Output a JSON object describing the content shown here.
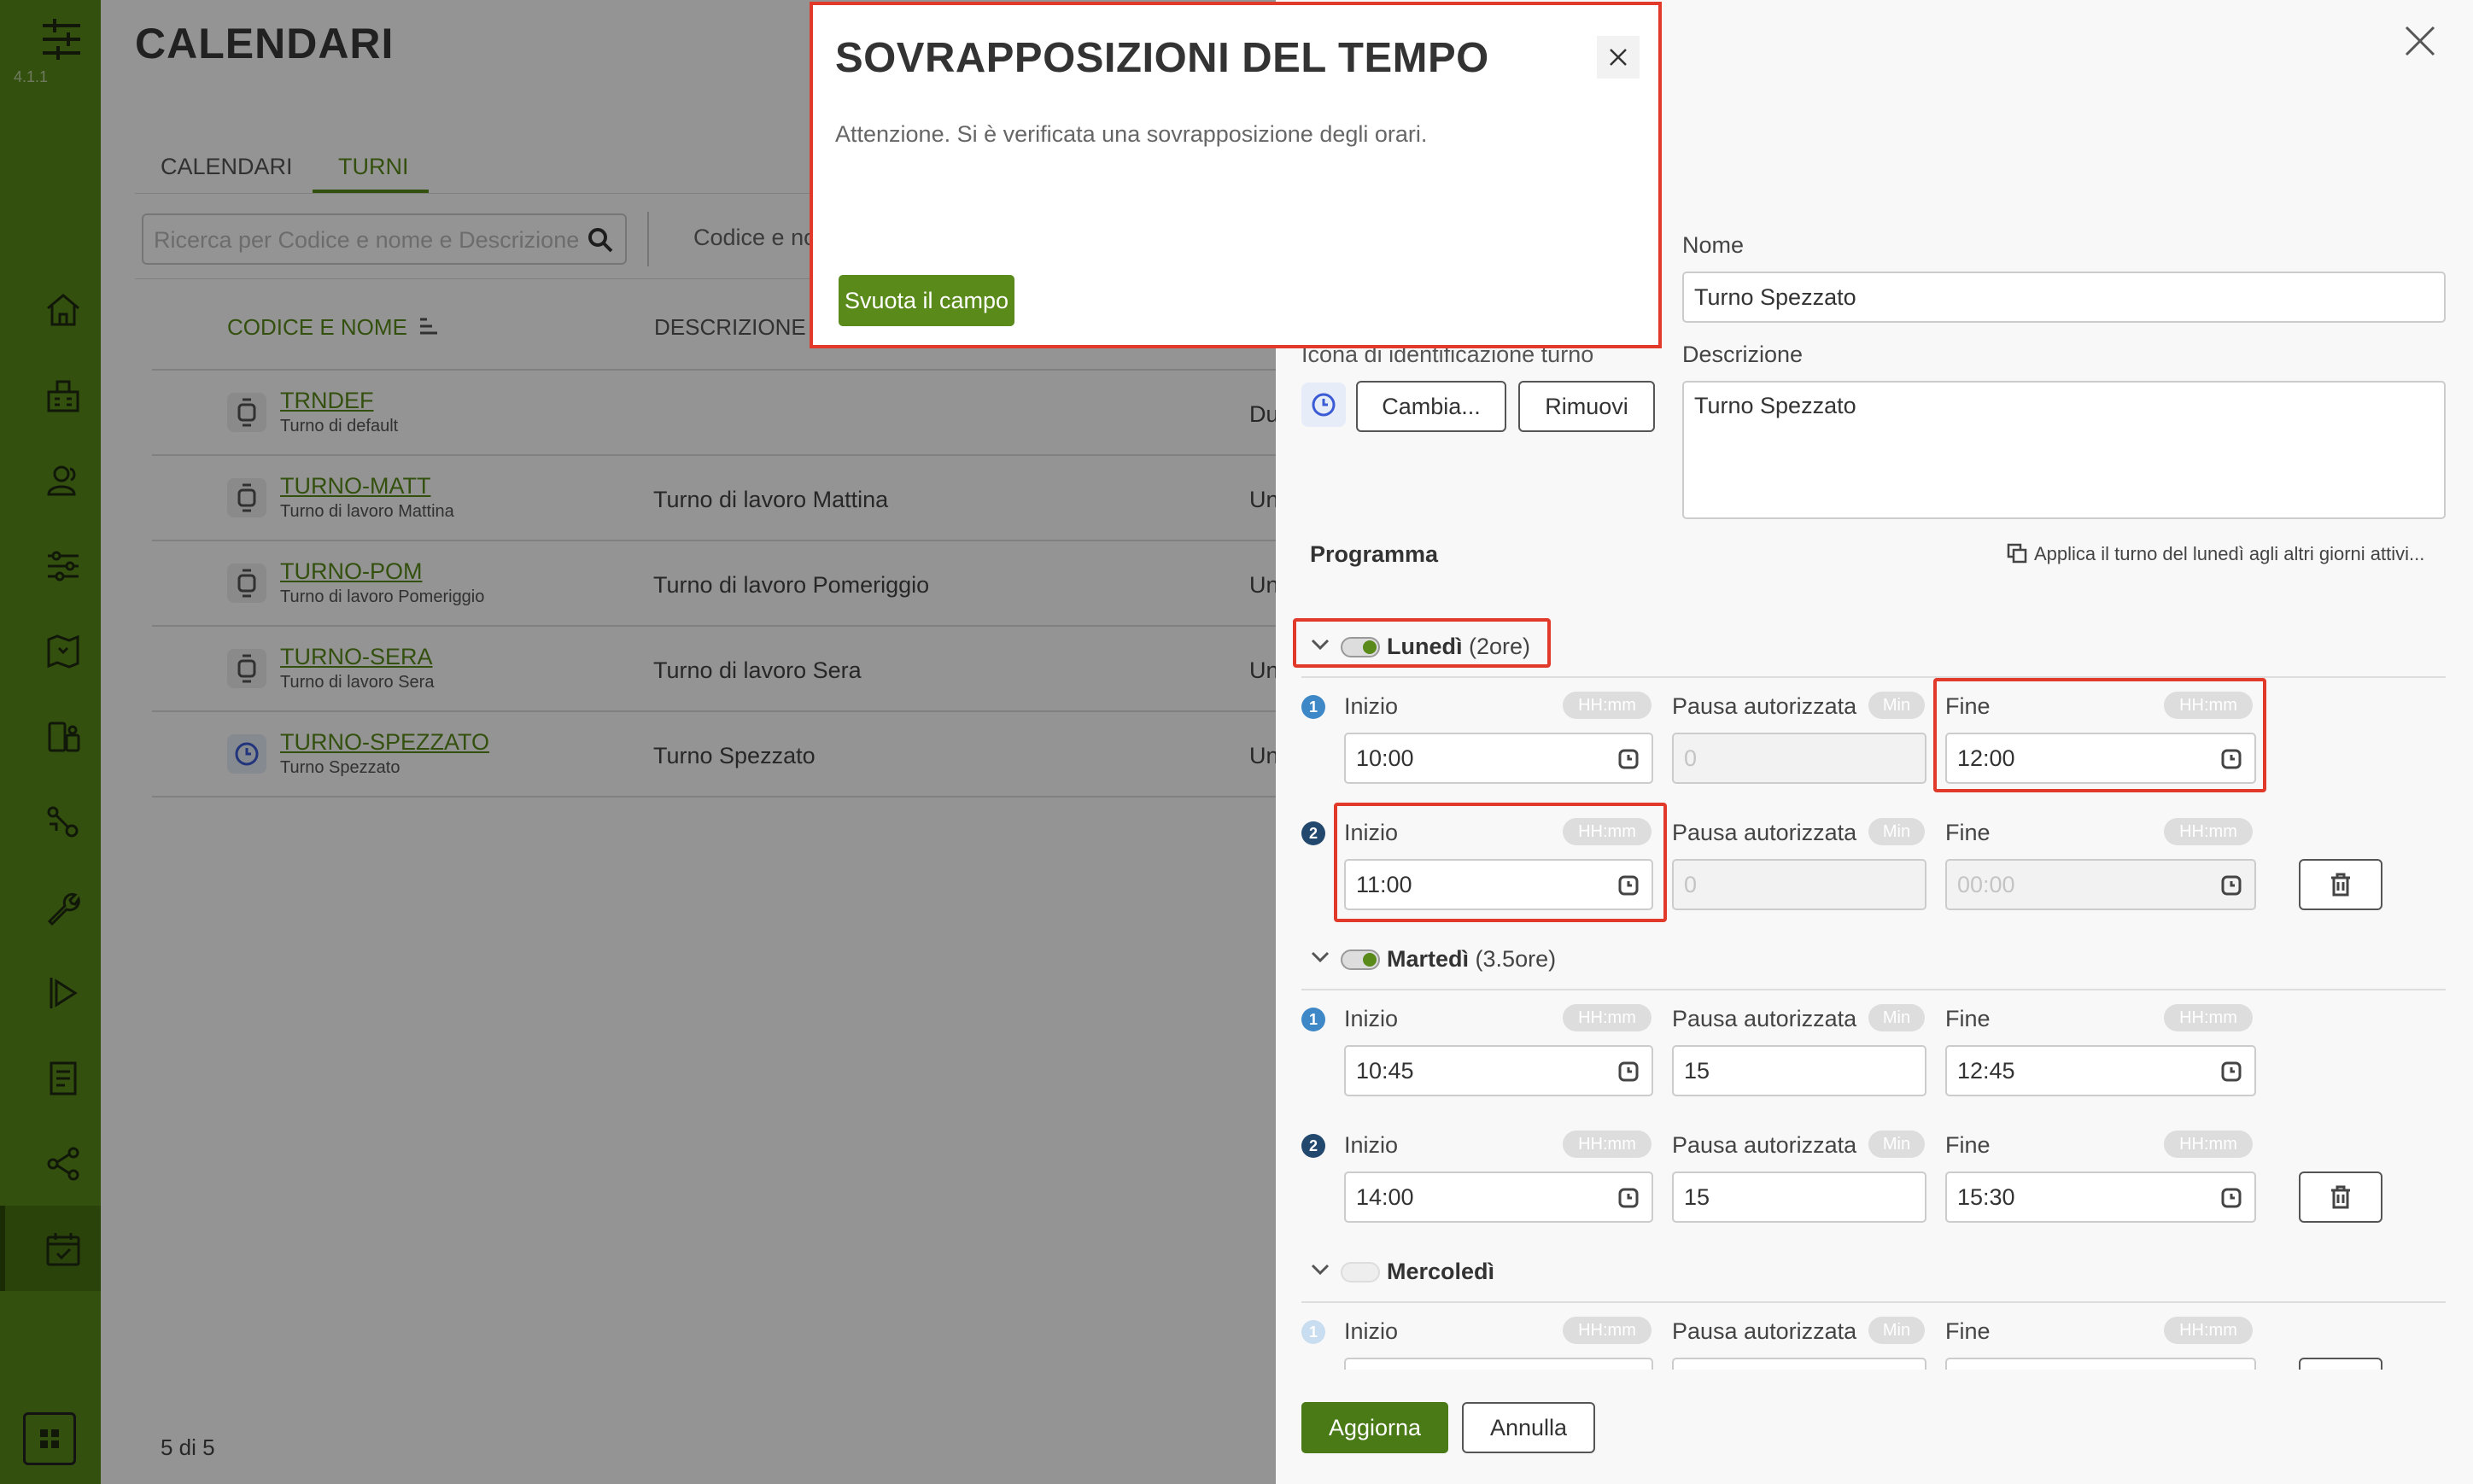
{
  "app": {
    "version": "4.1.1"
  },
  "page": {
    "title": "CALENDARI"
  },
  "tabs": [
    {
      "label": "CALENDARI"
    },
    {
      "label": "TURNI"
    }
  ],
  "search": {
    "placeholder": "Ricerca per Codice e nome e Descrizione",
    "filter_label": "Codice e no"
  },
  "table": {
    "headers": {
      "code_name": "CODICE E NOME",
      "description": "DESCRIZIONE"
    },
    "rows": [
      {
        "code": "TRNDEF",
        "subtitle": "Turno di default",
        "description": "",
        "extra": "Du"
      },
      {
        "code": "TURNO-MATT",
        "subtitle": "Turno di lavoro Mattina",
        "description": "Turno di lavoro Mattina",
        "extra": "Un"
      },
      {
        "code": "TURNO-POM",
        "subtitle": "Turno di lavoro Pomeriggio",
        "description": "Turno di lavoro Pomeriggio",
        "extra": "Un"
      },
      {
        "code": "TURNO-SERA",
        "subtitle": "Turno di lavoro Sera",
        "description": "Turno di lavoro Sera",
        "extra": "Un"
      },
      {
        "code": "TURNO-SPEZZATO",
        "subtitle": "Turno Spezzato",
        "description": "Turno Spezzato",
        "extra": "Un"
      }
    ],
    "count": "5 di 5"
  },
  "drawer": {
    "nome_label": "Nome",
    "nome_value": "Turno Spezzato",
    "icona_label": "Icona di identificazione turno",
    "cambia_label": "Cambia...",
    "rimuovi_label": "Rimuovi",
    "descrizione_label": "Descrizione",
    "descrizione_value": "Turno Spezzato",
    "programma_label": "Programma",
    "apply_label": "Applica il turno del lunedì agli altri giorni attivi...",
    "field_labels": {
      "inizio": "Inizio",
      "pausa": "Pausa autorizzata",
      "fine": "Fine",
      "hhmm": "HH:mm",
      "min": "Min"
    },
    "days": [
      {
        "name": "Lunedì",
        "hours": "(2ore)",
        "slots": [
          {
            "n": "1",
            "inizio": "10:00",
            "pausa": "0",
            "fine": "12:00"
          },
          {
            "n": "2",
            "inizio": "11:00",
            "pausa": "0",
            "fine": "00:00"
          }
        ]
      },
      {
        "name": "Martedì",
        "hours": "(3.5ore)",
        "slots": [
          {
            "n": "1",
            "inizio": "10:45",
            "pausa": "15",
            "fine": "12:45"
          },
          {
            "n": "2",
            "inizio": "14:00",
            "pausa": "15",
            "fine": "15:30"
          }
        ]
      },
      {
        "name": "Mercoledì",
        "hours": "",
        "slots": [
          {
            "n": "1"
          }
        ]
      }
    ],
    "aggiorna_label": "Aggiorna",
    "annulla_label": "Annulla"
  },
  "modal": {
    "title": "SOVRAPPOSIZIONI DEL TEMPO",
    "message": "Attenzione. Si è verificata una sovrapposizione degli orari.",
    "button_label": "Svuota il campo"
  },
  "colors": {
    "brand": "#5a8a1a",
    "highlight": "#e23a2a"
  }
}
